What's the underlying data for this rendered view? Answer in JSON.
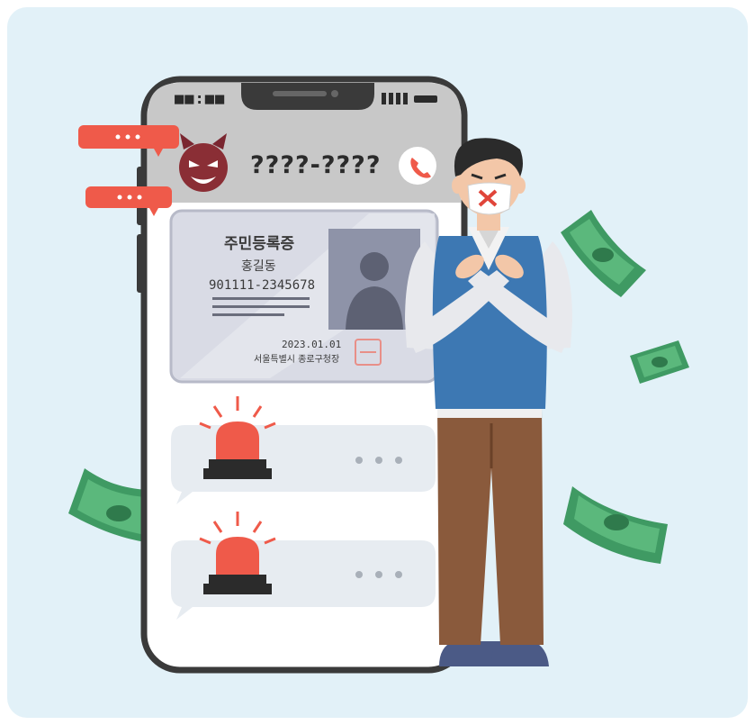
{
  "phone": {
    "status_left": "■■:■■",
    "caller_number": "????-????"
  },
  "id_card": {
    "title": "주민등록증",
    "name": "홍길동",
    "resident_number": "901111-2345678",
    "issue_date": "2023.01.01",
    "issuer": "서울특별시 종로구청장"
  },
  "icons": [
    "devil-icon",
    "phone-call-icon",
    "siren-icon",
    "no-entry-mask-icon",
    "money-bill-icon",
    "speech-bubble-icon"
  ],
  "colors": {
    "background": "#e2f1f8",
    "phone_body": "#ffffff",
    "phone_header": "#c8c8c8",
    "alert_red": "#ef5a4a",
    "money_green": "#3f9a63",
    "vest_blue": "#3d78b3",
    "pants_brown": "#8a5a3c",
    "devil_maroon": "#8a2e35"
  }
}
